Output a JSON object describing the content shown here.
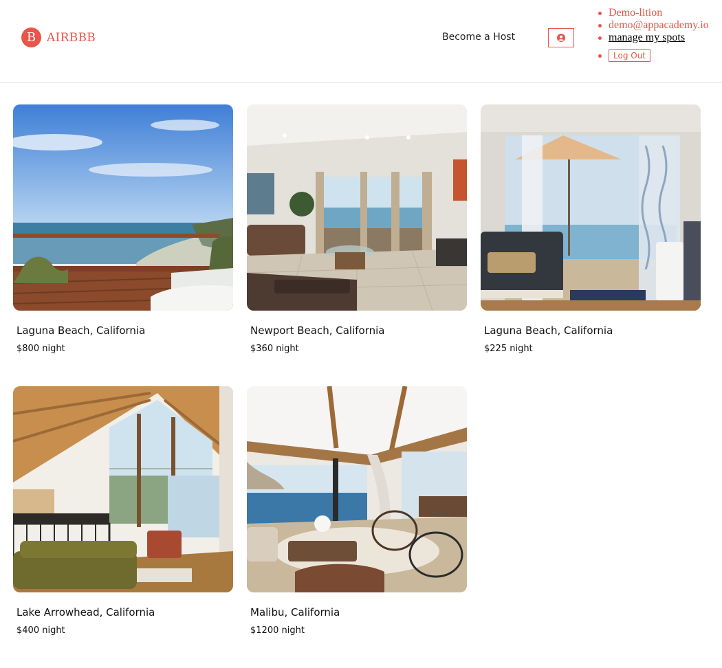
{
  "header": {
    "logo_initial": "B",
    "logo_text": "AIRBBB",
    "become_host": "Become a Host",
    "menu": {
      "name": "Demo-lition",
      "email": "demo@appacademy.io",
      "manage_spots": "manage my spots",
      "logout": "Log Out"
    }
  },
  "colors": {
    "brand": "#e8554b"
  },
  "spots": [
    {
      "location": "Laguna Beach, California",
      "price": "$800 night",
      "scene": "ocean-balcony"
    },
    {
      "location": "Newport Beach, California",
      "price": "$360 night",
      "scene": "living-room"
    },
    {
      "location": "Laguna Beach, California",
      "price": "$225 night",
      "scene": "patio-umbrella"
    },
    {
      "location": "Lake Arrowhead, California",
      "price": "$400 night",
      "scene": "cabin-interior"
    },
    {
      "location": "Malibu, California",
      "price": "$1200 night",
      "scene": "ocean-living"
    }
  ]
}
